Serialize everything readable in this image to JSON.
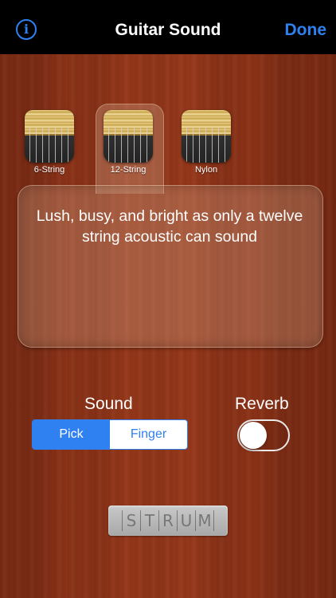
{
  "nav": {
    "info_icon": "info-icon",
    "info_glyph": "i",
    "title": "Guitar Sound",
    "done_label": "Done"
  },
  "guitars": [
    {
      "label": "6-String",
      "selected": false
    },
    {
      "label": "12-String",
      "selected": true
    },
    {
      "label": "Nylon",
      "selected": false
    }
  ],
  "description": "Lush, busy, and bright as only a twelve string acoustic can sound",
  "sound": {
    "label": "Sound",
    "options": [
      {
        "label": "Pick",
        "selected": true
      },
      {
        "label": "Finger",
        "selected": false
      }
    ]
  },
  "reverb": {
    "label": "Reverb",
    "on": false
  },
  "strum": {
    "letters": [
      "S",
      "T",
      "R",
      "U",
      "M"
    ]
  },
  "colors": {
    "accent": "#2f80f0",
    "nav_bg": "#000000",
    "wood": "#8f3418"
  }
}
